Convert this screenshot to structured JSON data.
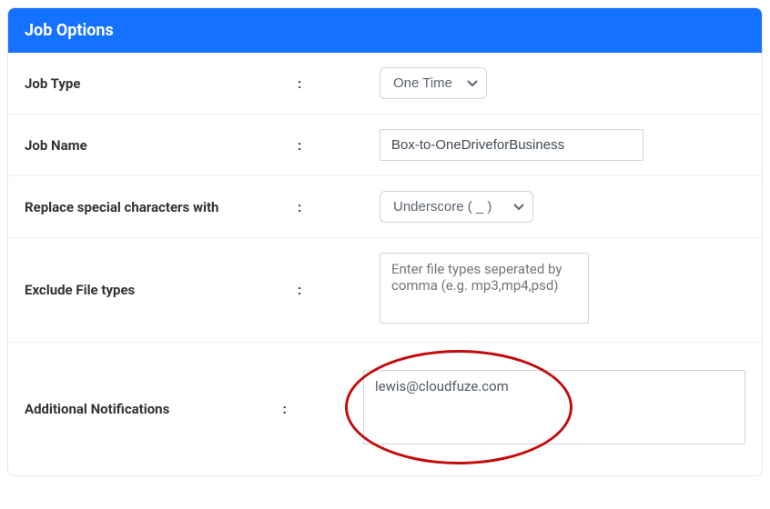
{
  "header": {
    "title": "Job Options"
  },
  "rows": {
    "job_type": {
      "label": "Job Type",
      "selected": "One Time"
    },
    "job_name": {
      "label": "Job Name",
      "value": "Box-to-OneDriveforBusiness"
    },
    "replace_chars": {
      "label": "Replace special characters with",
      "selected": "Underscore ( _ )"
    },
    "exclude_types": {
      "label": "Exclude File types",
      "value": "",
      "placeholder": "Enter file types seperated by comma (e.g. mp3,mp4,psd)"
    },
    "notifications": {
      "label": "Additional Notifications",
      "value": "lewis@cloudfuze.com"
    }
  },
  "colon": ":"
}
